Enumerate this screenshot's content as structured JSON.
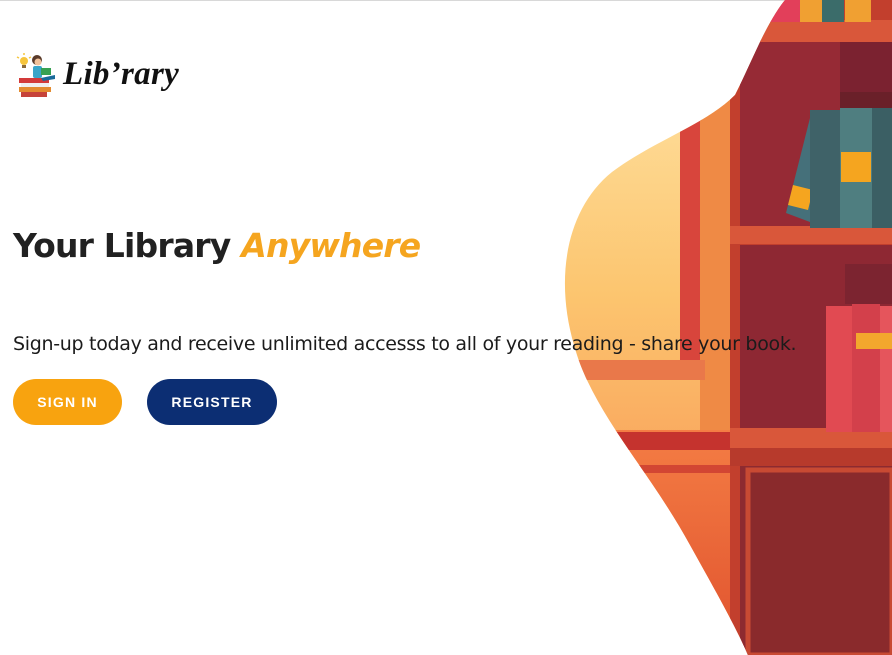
{
  "brand": {
    "name": "Lib’rary",
    "logo_icon": "reading-child-books-icon"
  },
  "hero": {
    "headline_main": "Your Library",
    "headline_accent": "Anywhere",
    "tagline": "Sign-up today and receive unlimited accesss to all of your reading - share your book."
  },
  "actions": {
    "signin_label": "SIGN IN",
    "register_label": "REGISTER"
  },
  "colors": {
    "accent": "#f5a51f",
    "signin_button": "#f8a30f",
    "register_button": "#0c2e73",
    "text": "#212121"
  },
  "illustration": "bookshelf-illustration"
}
